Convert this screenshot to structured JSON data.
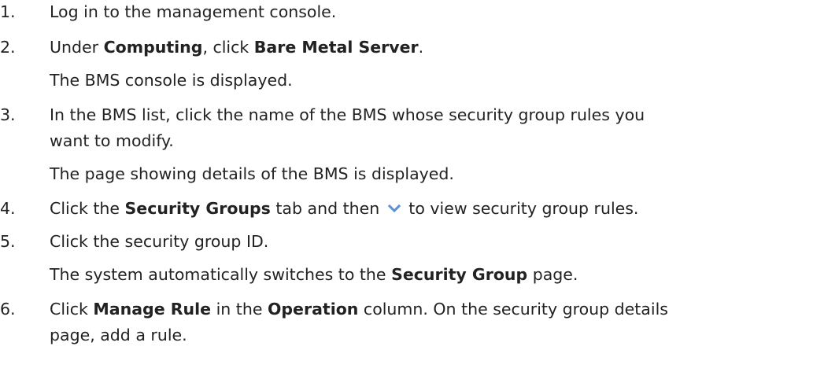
{
  "steps": [
    {
      "number": "1.",
      "text": "Log in to the management console."
    },
    {
      "number": "2.",
      "text_before": "Under ",
      "bold_1": "Computing",
      "text_middle": ", click ",
      "bold_2": "Bare Metal Server",
      "text_after": ".",
      "note": "The BMS console is displayed."
    },
    {
      "number": "3.",
      "line_1": "In the BMS list, click the name of the BMS whose security group rules you",
      "line_2": "want to modify.",
      "note": "The page showing details of the BMS is displayed."
    },
    {
      "number": "4.",
      "text_before": "Click the ",
      "bold_1": "Security Groups",
      "text_middle": " tab and then ",
      "icon": "chevron-down-icon",
      "text_after": " to view security group rules."
    },
    {
      "number": "5.",
      "text": "Click the security group ID.",
      "note_before": "The system automatically switches to the ",
      "note_bold": "Security Group",
      "note_after": " page."
    },
    {
      "number": "6.",
      "text_before": "Click ",
      "bold_1": "Manage Rule",
      "text_middle": " in the ",
      "bold_2": "Operation",
      "text_after": " column. On the security group details",
      "line_2": "page, add a rule."
    }
  ],
  "colors": {
    "text": "#222222",
    "chevron_icon": "#5b8fd6"
  }
}
